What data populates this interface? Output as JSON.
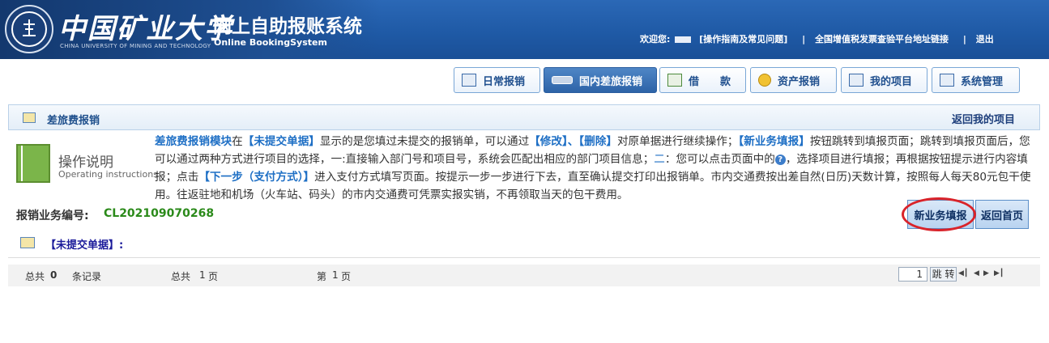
{
  "header": {
    "school_name": "中国矿业大学",
    "school_name_en": "CHINA UNIVERSITY OF MINING AND TECHNOLOGY",
    "system_title": "网上自助报账系统",
    "system_subtitle": "Online BookingSystem",
    "welcome_label": "欢迎您:",
    "links": {
      "guide": "[操作指南及常见问题]",
      "vat": "全国增值税发票查验平台地址链接",
      "logout": "退出"
    },
    "separator": "|"
  },
  "nav": {
    "tabs": [
      {
        "label": "日常报销"
      },
      {
        "label": "国内差旅报销",
        "active": true
      },
      {
        "label": "借　　款"
      },
      {
        "label": "资产报销"
      },
      {
        "label": "我的项目"
      },
      {
        "label": "系统管理"
      }
    ]
  },
  "section": {
    "title": "差旅费报销",
    "back_link": "返回我的项目"
  },
  "instructions": {
    "title": "操作说明",
    "subtitle": "Operating instructions",
    "segments": {
      "s1": "差旅费报销模块",
      "s2": "在",
      "s3": "【未提交单据】",
      "s4": "显示的是您填过未提交的报销单，可以通过",
      "s5": "【修改】、【删除】",
      "s6": "对原单据进行继续操作；",
      "s7": "【新业务填报】",
      "s8": "按钮跳转到填报页面；跳转到填报页面后，您可以通过两种方式进行项目的选择，一:直接输入部门号和项目号，系统会匹配出相应的部门项目信息；",
      "s9": "二",
      "s10": "：您可以点击页面中的",
      "s11": "，选择项目进行填报；再根据按钮提示进行内容填报；点击",
      "s12": "【下一步（支付方式）】",
      "s13": "进入支付方式填写页面。按提示一步一步进行下去，直至确认提交打印出报销单。市内交通费按出差自然(日历)天数计算，按照每人每天80元包干使用。往返驻地和机场（火车站、码头）的市内交通费可凭票实报实销，不再领取当天的包干费用。"
    }
  },
  "serial": {
    "label": "报销业务编号:",
    "value": "CL202109070268"
  },
  "buttons": {
    "new_business": "新业务填报",
    "return_home": "返回首页"
  },
  "unsubmitted": {
    "label": "【未提交单据】:"
  },
  "pager": {
    "total_label": "总共",
    "total_records": "0",
    "records_unit": "条记录",
    "pages_label": "总共",
    "total_pages": "1",
    "page_unit": "页",
    "current_label": "第",
    "current_page": "1",
    "current_unit": "页",
    "input_value": "1",
    "jump_label": "跳 转"
  },
  "colors": {
    "header_blue": "#1f5aa6",
    "highlight_blue": "#1e6fc5",
    "serial_green": "#2b8a1a",
    "annotation_red": "#d9232a"
  }
}
